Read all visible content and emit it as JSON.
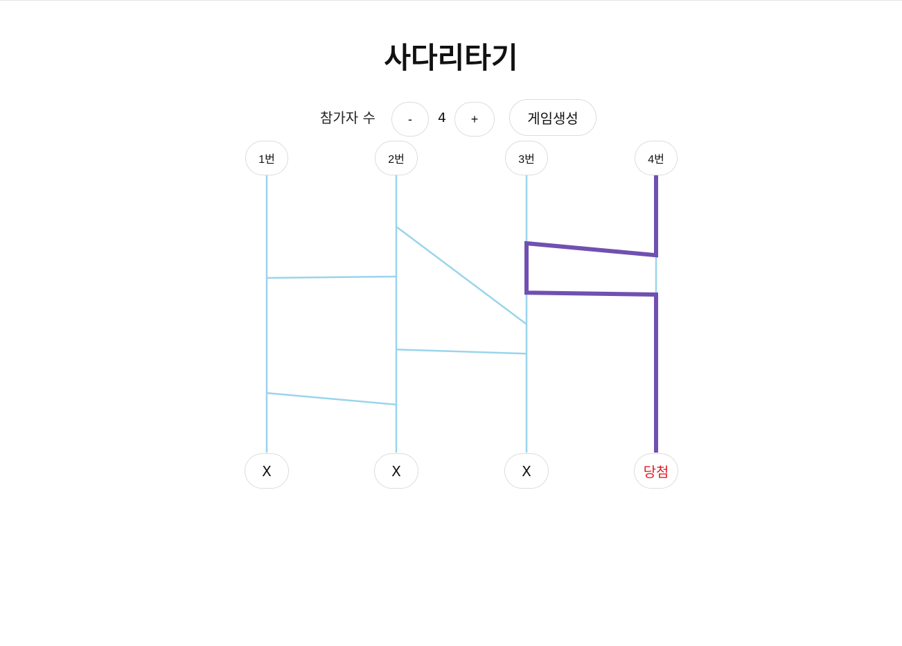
{
  "title": "사다리타기",
  "controls": {
    "participants_label": "참가자 수",
    "decrement_label": "-",
    "count": "4",
    "increment_label": "+",
    "generate_label": "게임생성"
  },
  "players": [
    "1번",
    "2번",
    "3번",
    "4번"
  ],
  "results": [
    {
      "label": "X",
      "winner": false
    },
    {
      "label": "X",
      "winner": false
    },
    {
      "label": "X",
      "winner": false
    },
    {
      "label": "당첨",
      "winner": true
    }
  ],
  "rungs": [
    {
      "from": 1,
      "to": 2,
      "y_from": 0.37,
      "y_to": 0.365
    },
    {
      "from": 1,
      "to": 2,
      "y_from": 0.785,
      "y_to": 0.827
    },
    {
      "from": 2,
      "to": 3,
      "y_from": 0.185,
      "y_to": 0.537
    },
    {
      "from": 2,
      "to": 3,
      "y_from": 0.628,
      "y_to": 0.643
    },
    {
      "from": 3,
      "to": 4,
      "y_from": 0.245,
      "y_to": 0.288
    },
    {
      "from": 3,
      "to": 4,
      "y_from": 0.423,
      "y_to": 0.43
    }
  ],
  "traced_path": {
    "player": 4,
    "result": 4,
    "color": "#7050b0"
  },
  "colors": {
    "ladder_line": "#9ad4ec",
    "winner_text": "#e0202a"
  }
}
